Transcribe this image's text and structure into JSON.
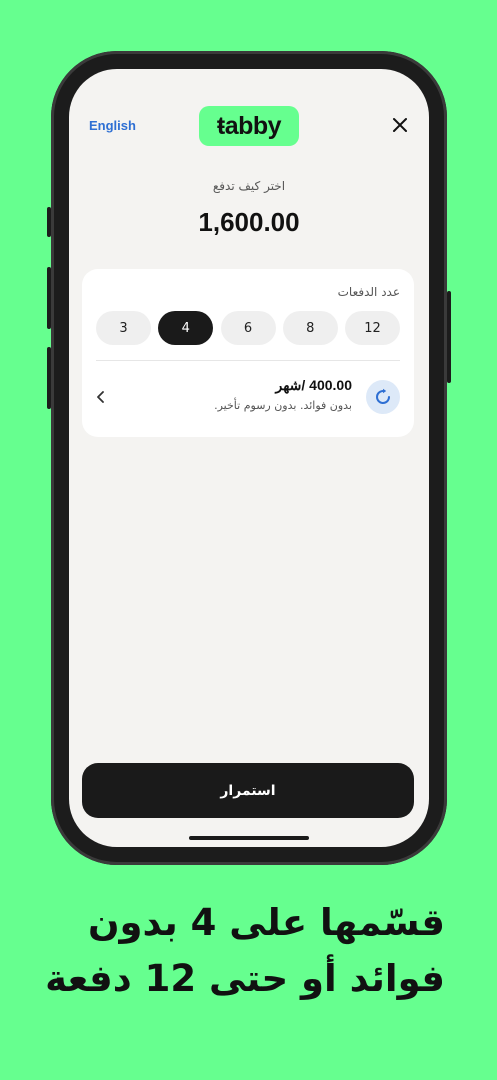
{
  "header": {
    "language_toggle": "English",
    "logo_text": "ŧabby"
  },
  "checkout": {
    "subtitle": "اختر كيف تدفع",
    "amount": "1,600.00"
  },
  "installments": {
    "label": "عدد الدفعات",
    "options": [
      "3",
      "4",
      "6",
      "8",
      "12"
    ],
    "selected": "4"
  },
  "plan": {
    "price": "400.00 /شهر",
    "note": "بدون فوائد. بدون رسوم تأخير."
  },
  "continue_label": "استمرار",
  "promo": {
    "line1": "قسّمها على 4 بدون",
    "line2": "فوائد أو حتى 12 دفعة"
  },
  "colors": {
    "background": "#66ff8f",
    "accent_blue": "#2e6fd3",
    "button_dark": "#1a1a1a"
  }
}
